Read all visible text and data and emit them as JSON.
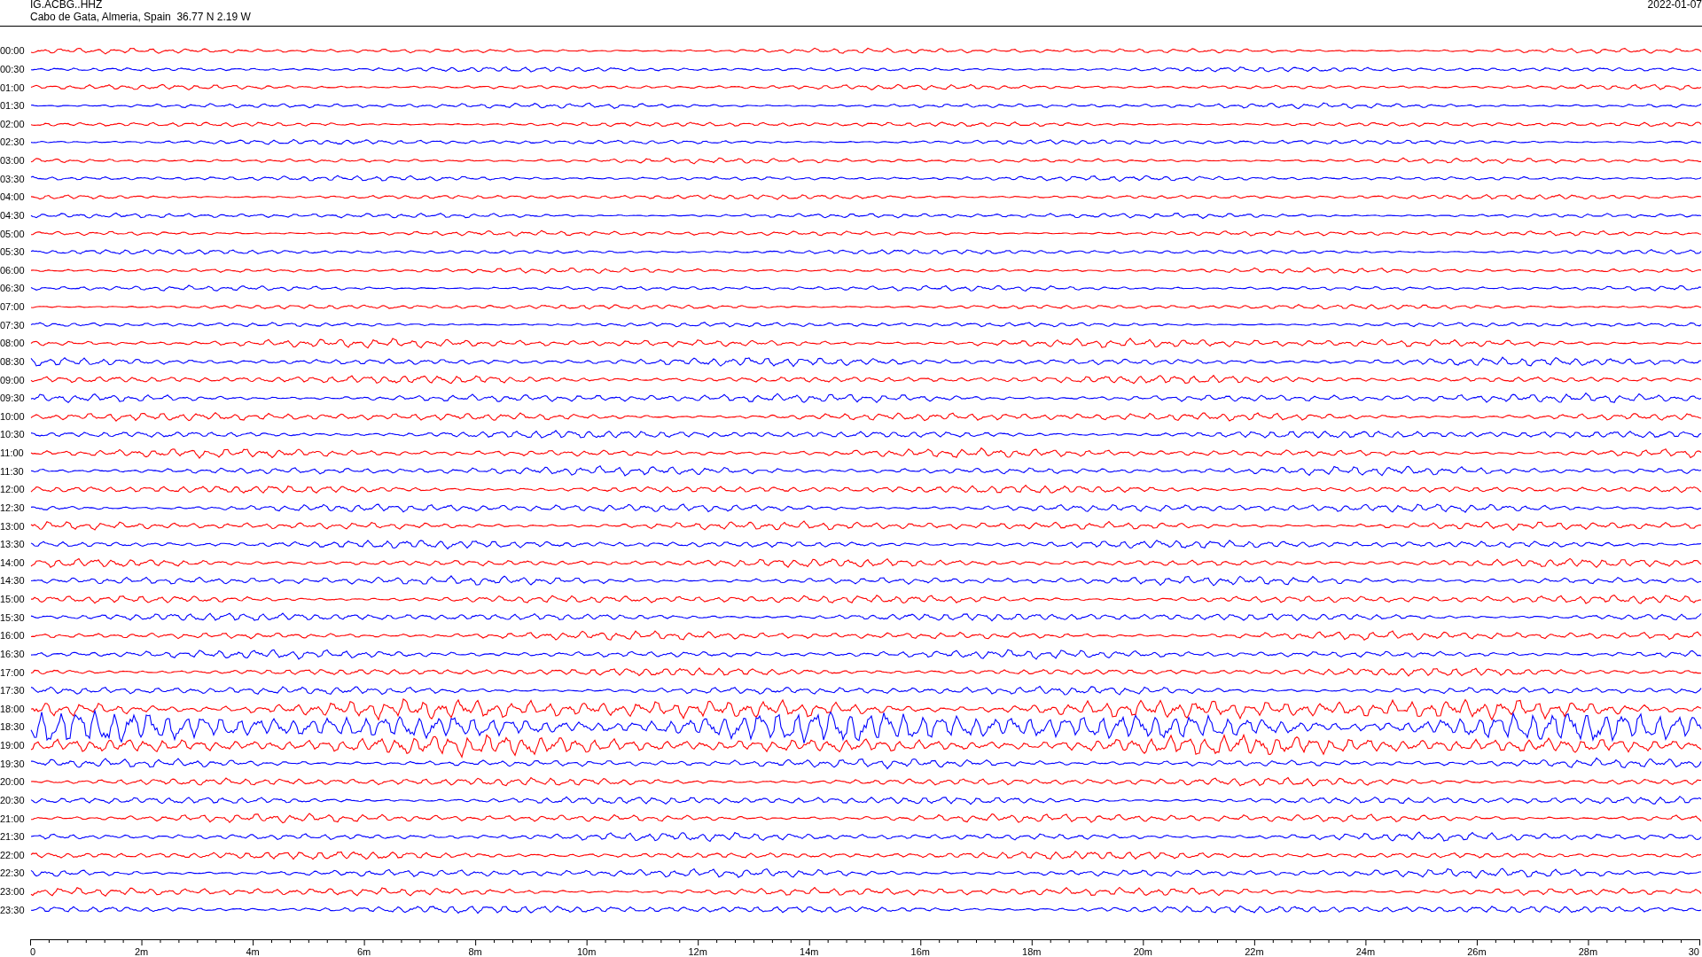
{
  "header": {
    "station": "IG.ACBG..HHZ",
    "location": "Cabo de Gata, Almeria, Spain  36.77 N 2.19 W",
    "date": "2022-01-07"
  },
  "traces": [
    {
      "time": "00:00",
      "color": "#ff0000",
      "kind": "quiet"
    },
    {
      "time": "00:30",
      "color": "#0000ff",
      "kind": "quiet"
    },
    {
      "time": "01:00",
      "color": "#ff0000",
      "kind": "quiet"
    },
    {
      "time": "01:30",
      "color": "#0000ff",
      "kind": "quiet"
    },
    {
      "time": "02:00",
      "color": "#ff0000",
      "kind": "quiet"
    },
    {
      "time": "02:30",
      "color": "#0000ff",
      "kind": "quiet"
    },
    {
      "time": "03:00",
      "color": "#ff0000",
      "kind": "quiet"
    },
    {
      "time": "03:30",
      "color": "#0000ff",
      "kind": "quiet"
    },
    {
      "time": "04:00",
      "color": "#ff0000",
      "kind": "quiet"
    },
    {
      "time": "04:30",
      "color": "#0000ff",
      "kind": "quiet"
    },
    {
      "time": "05:00",
      "color": "#ff0000",
      "kind": "quiet"
    },
    {
      "time": "05:30",
      "color": "#0000ff",
      "kind": "quiet"
    },
    {
      "time": "06:00",
      "color": "#ff0000",
      "kind": "quiet"
    },
    {
      "time": "06:30",
      "color": "#0000ff",
      "kind": "quiet"
    },
    {
      "time": "07:00",
      "color": "#ff0000",
      "kind": "quiet"
    },
    {
      "time": "07:30",
      "color": "#0000ff",
      "kind": "quiet"
    },
    {
      "time": "08:00",
      "color": "#ff0000",
      "kind": "moderate"
    },
    {
      "time": "08:30",
      "color": "#0000ff",
      "kind": "moderate"
    },
    {
      "time": "09:00",
      "color": "#ff0000",
      "kind": "moderate"
    },
    {
      "time": "09:30",
      "color": "#0000ff",
      "kind": "moderate"
    },
    {
      "time": "10:00",
      "color": "#ff0000",
      "kind": "moderate"
    },
    {
      "time": "10:30",
      "color": "#0000ff",
      "kind": "moderate"
    },
    {
      "time": "11:00",
      "color": "#ff0000",
      "kind": "moderate"
    },
    {
      "time": "11:30",
      "color": "#0000ff",
      "kind": "moderate"
    },
    {
      "time": "12:00",
      "color": "#ff0000",
      "kind": "moderate"
    },
    {
      "time": "12:30",
      "color": "#0000ff",
      "kind": "moderate"
    },
    {
      "time": "13:00",
      "color": "#ff0000",
      "kind": "moderate"
    },
    {
      "time": "13:30",
      "color": "#0000ff",
      "kind": "moderate"
    },
    {
      "time": "14:00",
      "color": "#ff0000",
      "kind": "moderate"
    },
    {
      "time": "14:30",
      "color": "#0000ff",
      "kind": "moderate"
    },
    {
      "time": "15:00",
      "color": "#ff0000",
      "kind": "moderate"
    },
    {
      "time": "15:30",
      "color": "#0000ff",
      "kind": "moderate"
    },
    {
      "time": "16:00",
      "color": "#ff0000",
      "kind": "moderate"
    },
    {
      "time": "16:30",
      "color": "#0000ff",
      "kind": "moderate"
    },
    {
      "time": "17:00",
      "color": "#ff0000",
      "kind": "moderate"
    },
    {
      "time": "17:30",
      "color": "#0000ff",
      "kind": "moderate"
    },
    {
      "time": "18:00",
      "color": "#ff0000",
      "kind": "strong"
    },
    {
      "time": "18:30",
      "color": "#0000ff",
      "kind": "extreme"
    },
    {
      "time": "19:00",
      "color": "#ff0000",
      "kind": "strong"
    },
    {
      "time": "19:30",
      "color": "#0000ff",
      "kind": "moderate"
    },
    {
      "time": "20:00",
      "color": "#ff0000",
      "kind": "moderate"
    },
    {
      "time": "20:30",
      "color": "#0000ff",
      "kind": "moderate"
    },
    {
      "time": "21:00",
      "color": "#ff0000",
      "kind": "moderate"
    },
    {
      "time": "21:30",
      "color": "#0000ff",
      "kind": "moderate"
    },
    {
      "time": "22:00",
      "color": "#ff0000",
      "kind": "moderate"
    },
    {
      "time": "22:30",
      "color": "#0000ff",
      "kind": "moderate"
    },
    {
      "time": "23:00",
      "color": "#ff0000",
      "kind": "moderate"
    },
    {
      "time": "23:30",
      "color": "#0000ff",
      "kind": "moderate"
    }
  ],
  "axis": {
    "labels": [
      "0",
      "2m",
      "4m",
      "6m",
      "8m",
      "10m",
      "12m",
      "14m",
      "16m",
      "18m",
      "20m",
      "22m",
      "24m",
      "26m",
      "28m",
      "30"
    ]
  }
}
